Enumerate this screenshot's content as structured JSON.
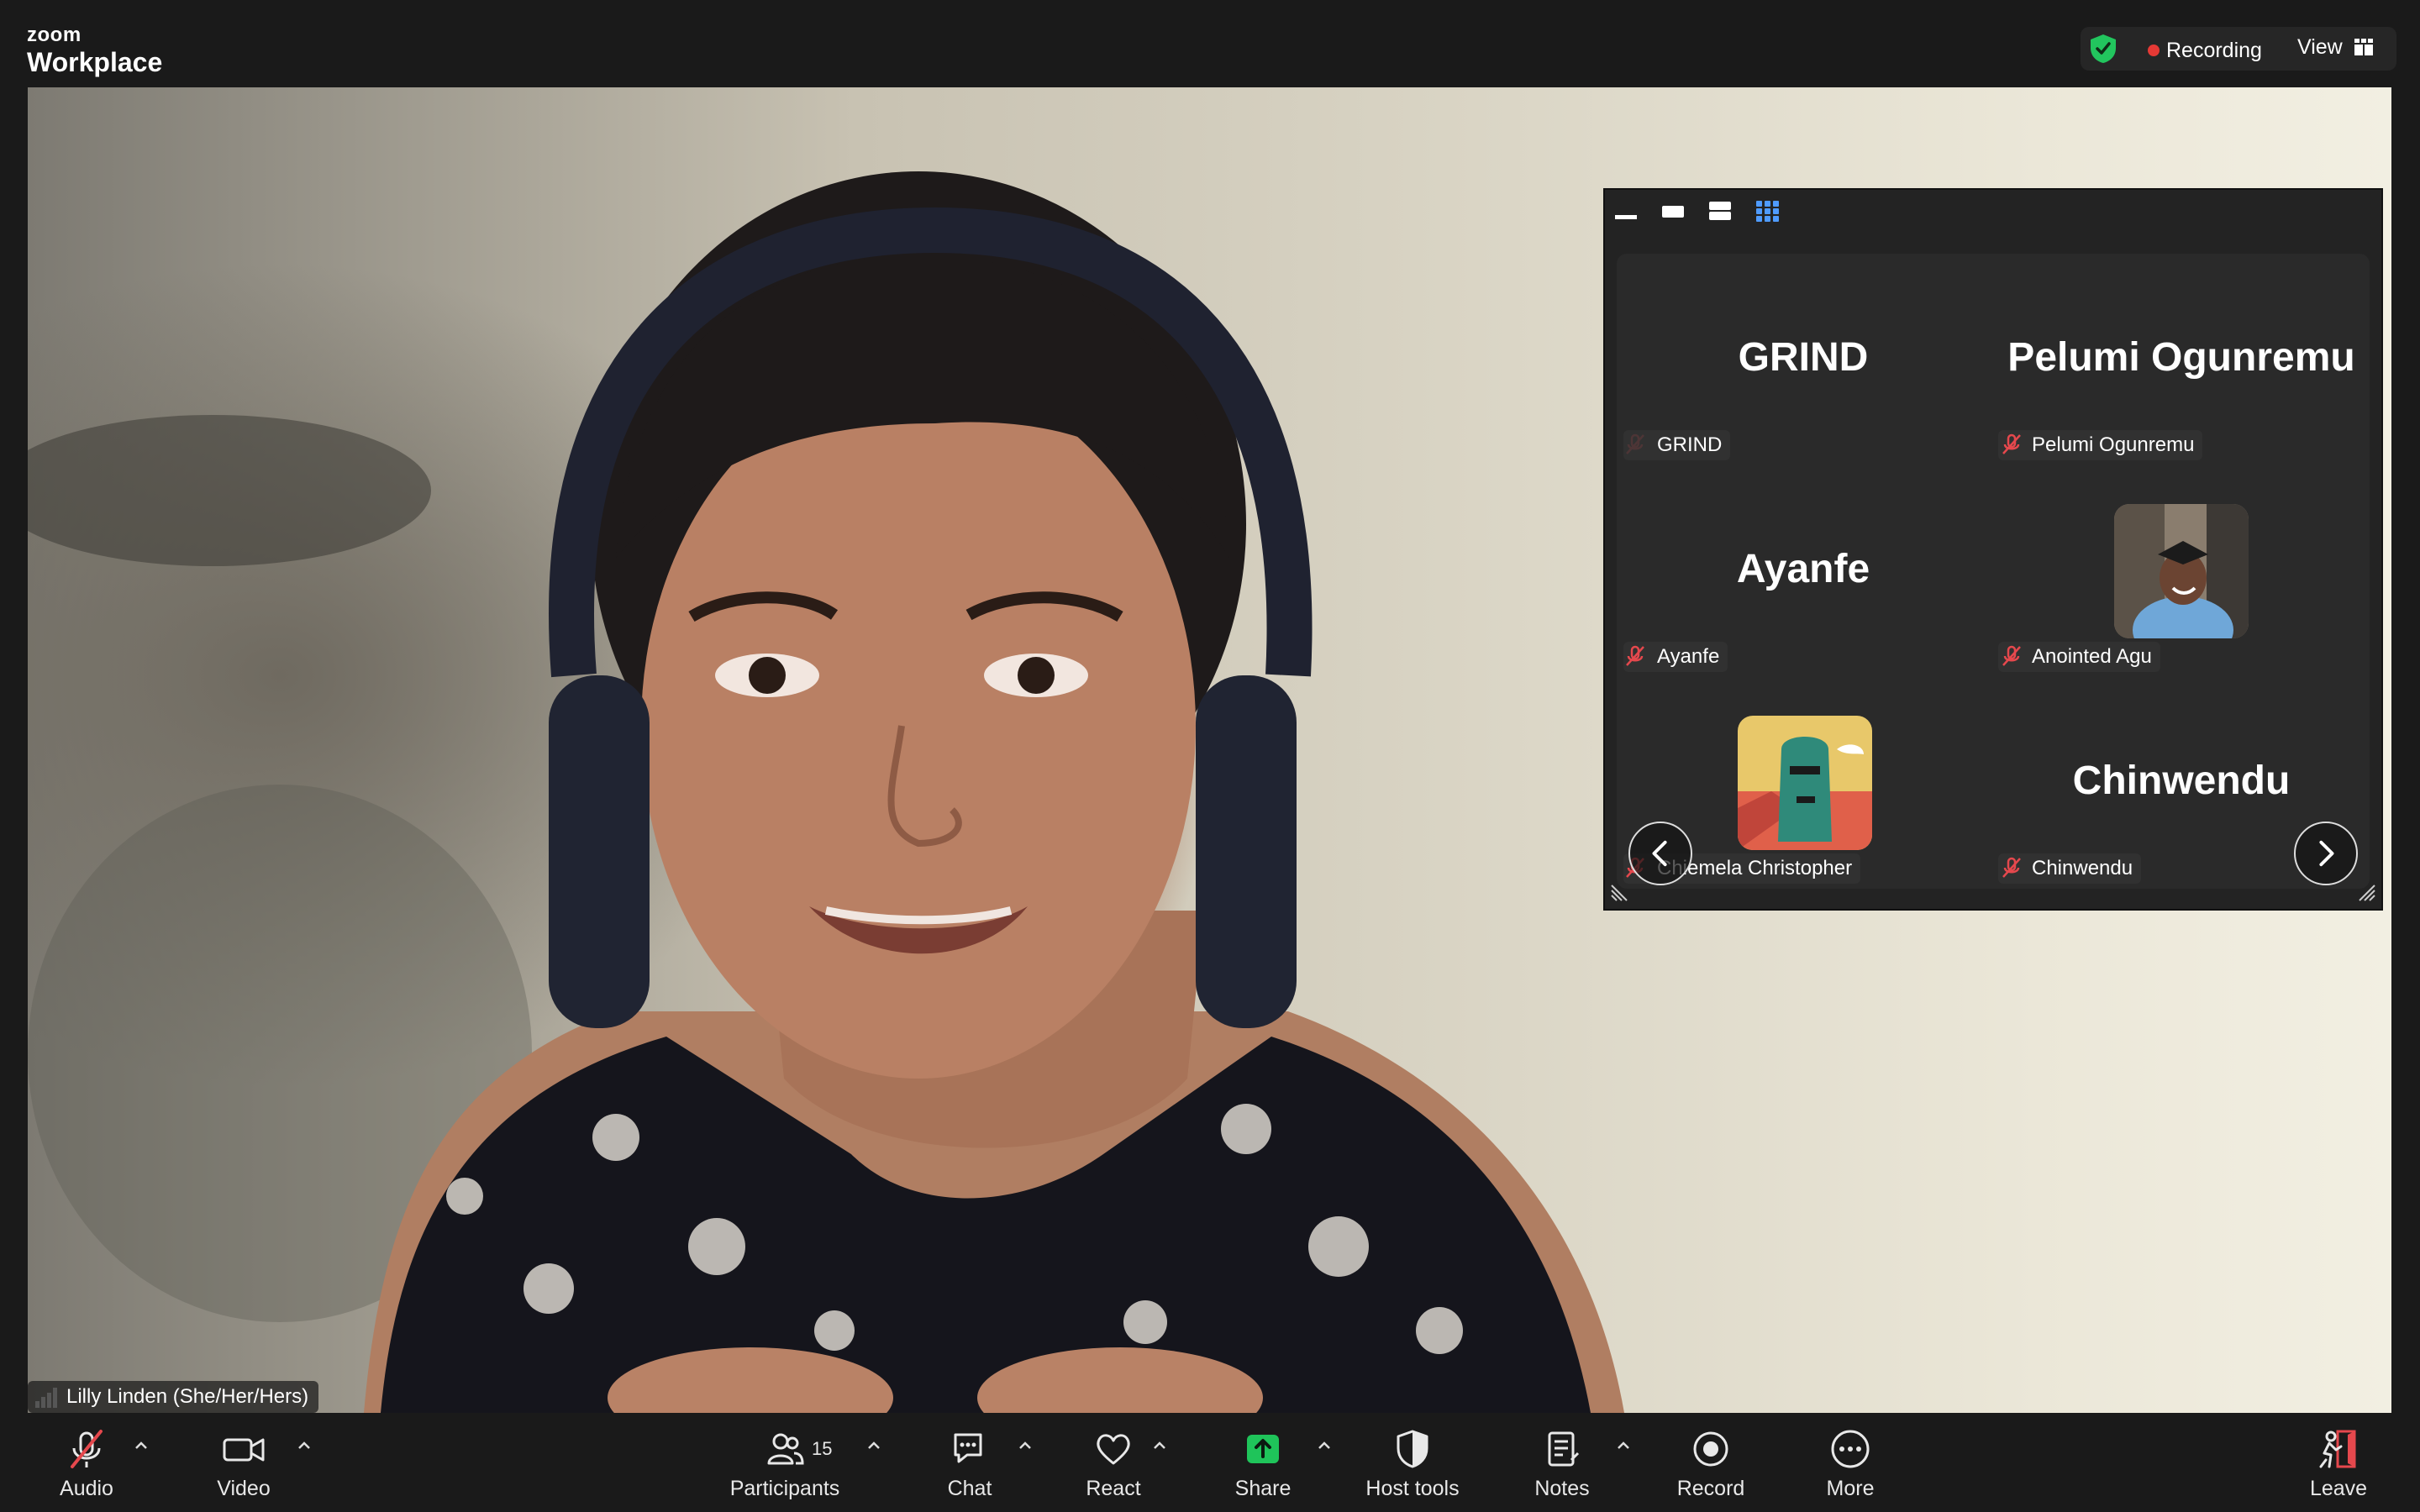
{
  "app": {
    "brand_top": "zoom",
    "brand_bottom": "Workplace"
  },
  "status": {
    "recording_label": "Recording",
    "view_label": "View"
  },
  "main_video": {
    "speaker_name": "Lilly Linden (She/Her/Hers)"
  },
  "gallery": {
    "tiles": [
      {
        "display_name": "GRIND",
        "label": "GRIND",
        "has_avatar": false
      },
      {
        "display_name": "Pelumi Ogunremu",
        "label": "Pelumi Ogunremu",
        "has_avatar": false
      },
      {
        "display_name": "Ayanfe",
        "label": "Ayanfe",
        "has_avatar": false
      },
      {
        "display_name": "",
        "label": "Anointed Agu",
        "has_avatar": true
      },
      {
        "display_name": "",
        "label": "Chiemela Christopher",
        "has_avatar": true
      },
      {
        "display_name": "Chinwendu",
        "label": "Chinwendu",
        "has_avatar": false
      }
    ]
  },
  "toolbar": {
    "audio": "Audio",
    "video": "Video",
    "participants": "Participants",
    "participants_count": "15",
    "chat": "Chat",
    "react": "React",
    "share": "Share",
    "host_tools": "Host tools",
    "notes": "Notes",
    "record": "Record",
    "more": "More",
    "leave": "Leave"
  },
  "colors": {
    "share_green": "#1fc45a",
    "recording_red": "#e53935",
    "mute_red": "#e5484d",
    "leave_red": "#e5484d",
    "shield_green": "#22c55e",
    "grid_blue": "#4f9bff"
  }
}
